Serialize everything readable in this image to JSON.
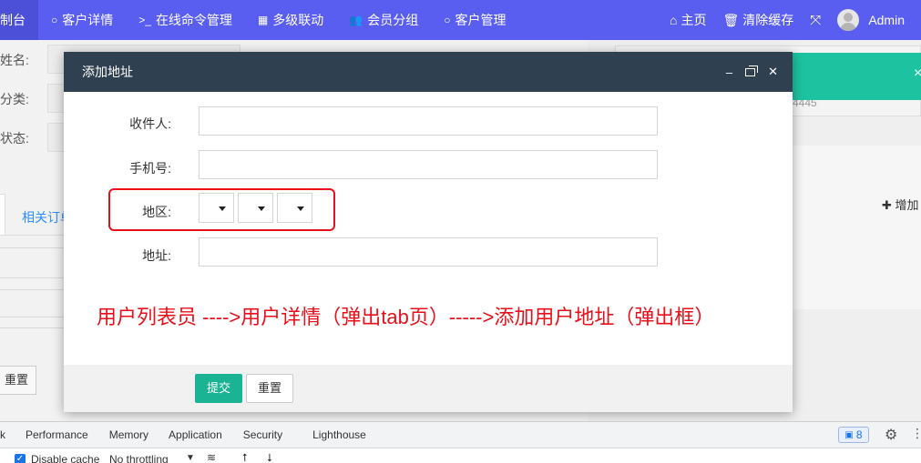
{
  "topnav": {
    "tabs": [
      {
        "label": "制台",
        "icon": ""
      },
      {
        "label": "客户详情",
        "icon": "circle-icon"
      },
      {
        "label": "在线命令管理",
        "icon": "terminal-icon"
      },
      {
        "label": "多级联动",
        "icon": "table-icon"
      },
      {
        "label": "会员分组",
        "icon": "users-icon"
      },
      {
        "label": "客户管理",
        "icon": "circle-icon"
      }
    ],
    "home_label": "主页",
    "clear_cache_label": "清除缓存",
    "user_name": "Admin"
  },
  "background": {
    "field_labels": [
      "姓名:",
      "分类:",
      "状态:"
    ],
    "field_values": [
      "",
      "",
      ""
    ],
    "orders_tab": "相关订单",
    "reset_label": "重置",
    "right_number": "4445",
    "add_label": "增加"
  },
  "dialog": {
    "title": "添加地址",
    "fields": {
      "receiver_label": "收件人:",
      "phone_label": "手机号:",
      "region_label": "地区:",
      "address_label": "地址:"
    },
    "annotation": "用户列表员 ---->用户详情（弹出tab页）----->添加用户地址（弹出框）",
    "submit_label": "提交",
    "reset_label": "重置"
  },
  "devtools": {
    "tabs": [
      "k",
      "Performance",
      "Memory",
      "Application",
      "Security",
      "Lighthouse"
    ],
    "disable_cache_label": "Disable cache",
    "throttling_label": "No throttling",
    "issues_count": "8"
  },
  "colors": {
    "nav_bg": "#5a5ef0",
    "dialog_header": "#2f4050",
    "submit_green": "#1ab394",
    "annotation_red": "#e8101a",
    "notice_green": "#1dc3a0"
  }
}
